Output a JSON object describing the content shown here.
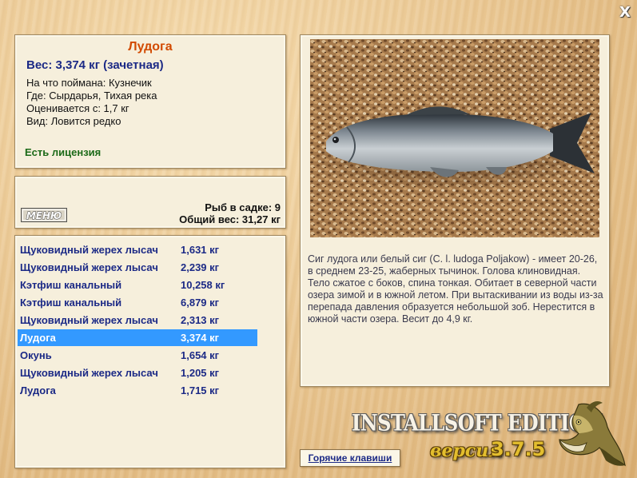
{
  "window": {
    "close_label": "X"
  },
  "catch": {
    "title": "Лудога",
    "weight": "Вес: 3,374 кг (зачетная)",
    "bait": "На что поймана: Кузнечик",
    "location": "Где: Сырдарья, Тихая река",
    "valued_from": "Оценивается с: 1,7 кг",
    "species_note": "Вид: Ловится редко",
    "license": "Есть лицензия"
  },
  "keepnet": {
    "menu_button": "МЕНЮ",
    "count": "Рыб в садке: 9",
    "total_weight": "Общий вес: 31,27 кг"
  },
  "fish_list": [
    {
      "name": "Щуковидный жерех лысач",
      "weight": "1,631 кг",
      "selected": false
    },
    {
      "name": "Щуковидный жерех лысач",
      "weight": "2,239 кг",
      "selected": false
    },
    {
      "name": "Кэтфиш канальный",
      "weight": "10,258 кг",
      "selected": false
    },
    {
      "name": "Кэтфиш канальный",
      "weight": "6,879 кг",
      "selected": false
    },
    {
      "name": "Щуковидный жерех лысач",
      "weight": "2,313 кг",
      "selected": false
    },
    {
      "name": "Лудога",
      "weight": "3,374 кг",
      "selected": true
    },
    {
      "name": "Окунь",
      "weight": "1,654 кг",
      "selected": false
    },
    {
      "name": "Щуковидный жерех лысач",
      "weight": "1,205 кг",
      "selected": false
    },
    {
      "name": "Лудога",
      "weight": "1,715 кг",
      "selected": false
    }
  ],
  "description": "Сиг лудога или белый сиг (C. l. ludoga Poljakow) - имеет 20-26, в среднем 23-25, жаберных тычинок. Голова клиновидная. Тело сжатое с боков, спина тонкая. Обитает в северной части озера зимой и в южной летом. При вытаскивании из воды из-за перепада давления образуется небольшой зоб. Нерестится в южной части озера. Весит до 4,9 кг.",
  "hotkeys_button": "Горячие клавиши",
  "branding": {
    "edition": "INSTALLSOFT EDITION",
    "version_label": "версия",
    "version": "3.7.5"
  },
  "colors": {
    "title": "#d24a00",
    "weight": "#1c2a86",
    "license": "#1c6a18",
    "selection": "#3399ff"
  }
}
